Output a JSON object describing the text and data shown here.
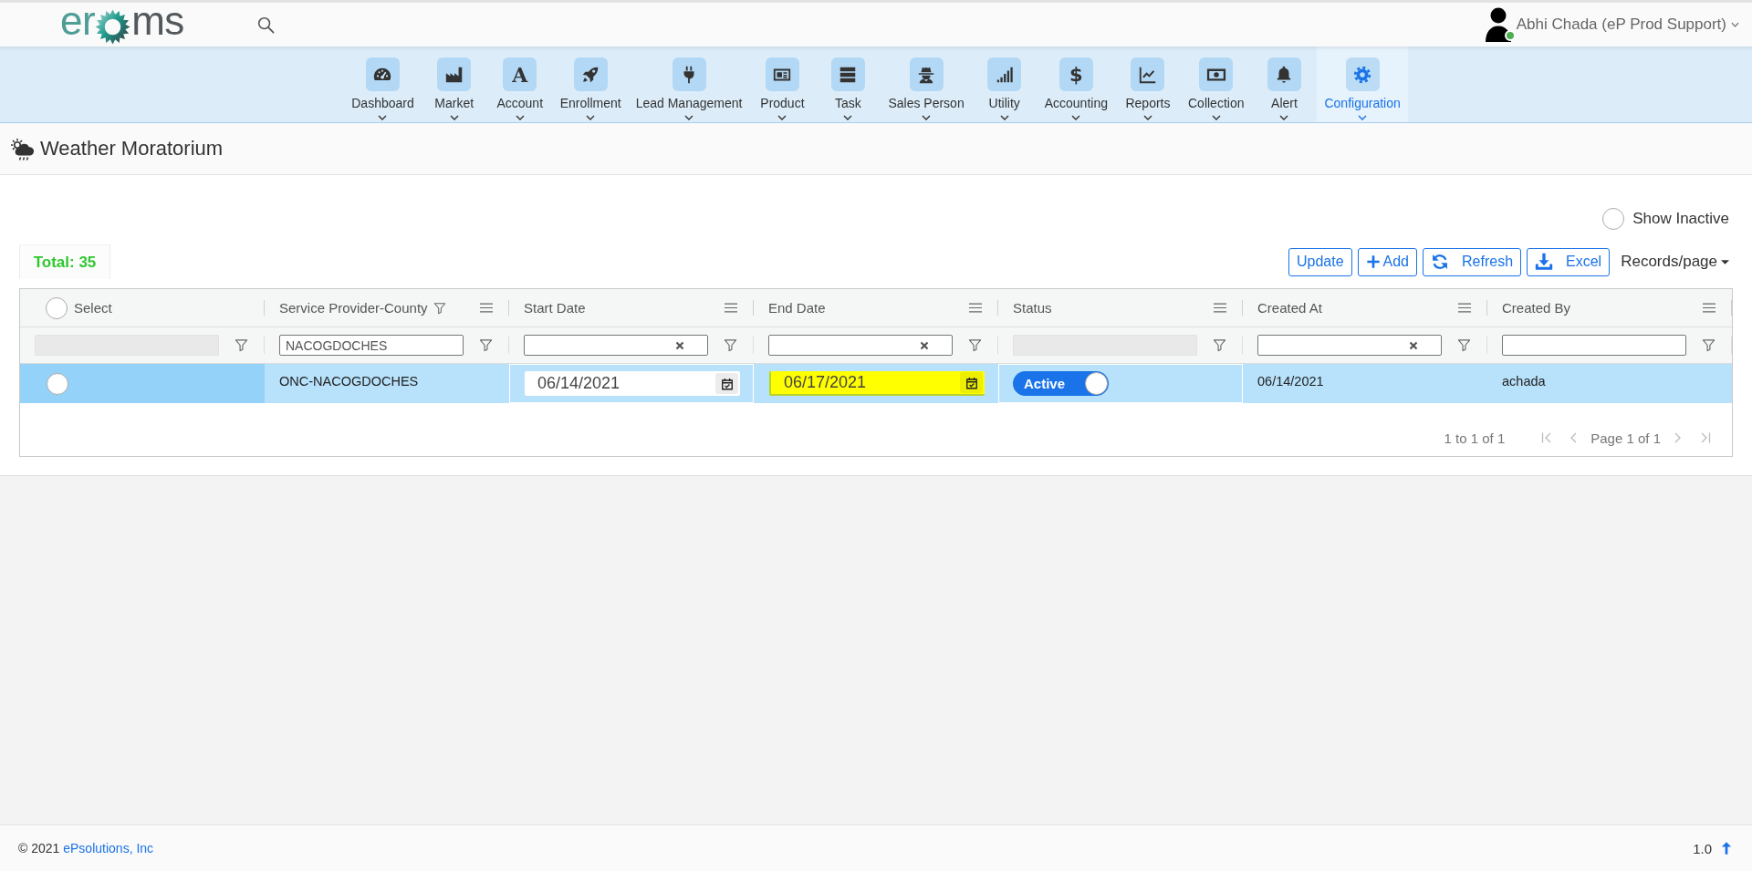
{
  "header": {
    "logo": {
      "prefix": "er",
      "suffix": "ms"
    },
    "user": {
      "name": "Abhi Chada (eP Prod Support)",
      "online": true
    }
  },
  "nav": [
    {
      "label": "Dashboard",
      "selected": false
    },
    {
      "label": "Market",
      "selected": false
    },
    {
      "label": "Account",
      "glyph": "A",
      "selected": false
    },
    {
      "label": "Enrollment",
      "selected": false
    },
    {
      "label": "Lead Management",
      "selected": false
    },
    {
      "label": "Product",
      "selected": false
    },
    {
      "label": "Task",
      "selected": false
    },
    {
      "label": "Sales Person",
      "selected": false
    },
    {
      "label": "Utility",
      "selected": false
    },
    {
      "label": "Accounting",
      "glyph": "$",
      "selected": false
    },
    {
      "label": "Reports",
      "selected": false
    },
    {
      "label": "Collection",
      "selected": false
    },
    {
      "label": "Alert",
      "selected": false
    },
    {
      "label": "Configuration",
      "selected": true
    }
  ],
  "page": {
    "title": "Weather Moratorium"
  },
  "show_inactive": {
    "label": "Show Inactive",
    "checked": false
  },
  "total": "Total: 35",
  "toolbar": {
    "buttons": [
      "Update",
      "Add",
      "Refresh",
      "Excel"
    ],
    "records_per_page": "Records/page"
  },
  "grid": {
    "select_all_checked": false,
    "columns": [
      {
        "label": "Select",
        "kind": "select",
        "filtered": false
      },
      {
        "label": "Service Provider-County",
        "kind": "data",
        "filtered": true
      },
      {
        "label": "Start Date",
        "kind": "data",
        "filtered": false
      },
      {
        "label": "End Date",
        "kind": "data",
        "filtered": false
      },
      {
        "label": "Status",
        "kind": "data",
        "filtered": false
      },
      {
        "label": "Created At",
        "kind": "data",
        "filtered": false
      },
      {
        "label": "Created By",
        "kind": "data",
        "filtered": false
      }
    ],
    "filters": [
      {
        "kind": "disabled"
      },
      {
        "kind": "text",
        "value": "NACOGDOCHES"
      },
      {
        "kind": "clearable"
      },
      {
        "kind": "clearable"
      },
      {
        "kind": "disabled"
      },
      {
        "kind": "clearable"
      },
      {
        "kind": "text"
      }
    ],
    "rows": [
      {
        "selected": false,
        "focused": true,
        "provider_county": "ONC-NACOGDOCHES",
        "start_date": {
          "value": "06/14/2021",
          "editing": true,
          "highlighted": false
        },
        "end_date": {
          "value": "06/17/2021",
          "editing": false,
          "highlighted": true
        },
        "status": {
          "label": "Active",
          "on": true,
          "editing": true
        },
        "created_at": "06/14/2021",
        "created_by": "achada"
      }
    ],
    "pagination": {
      "summary": "1 to 1 of 1",
      "page": "Page 1 of 1",
      "first_disabled": true,
      "prev_disabled": true,
      "next_disabled": true,
      "last_disabled": true
    }
  },
  "footer": {
    "copyright": "© 2021",
    "company": "ePsolutions, Inc",
    "version": "1.0"
  }
}
